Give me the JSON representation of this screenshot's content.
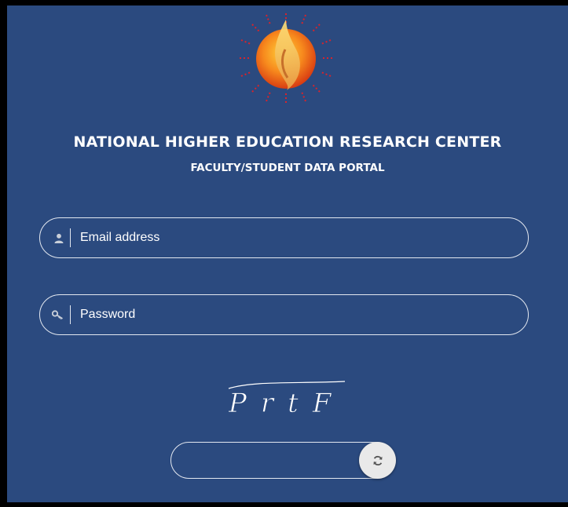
{
  "app": {
    "title": "NATIONAL HIGHER EDUCATION RESEARCH CENTER",
    "subtitle": "FACULTY/STUDENT DATA PORTAL"
  },
  "form": {
    "email": {
      "placeholder": "Email address",
      "value": ""
    },
    "password": {
      "placeholder": "Password",
      "value": ""
    },
    "captcha": {
      "text": "PrtF",
      "input_value": ""
    }
  },
  "icons": {
    "logo": "flame-sun-logo",
    "email": "user-icon",
    "password": "key-icon",
    "refresh": "refresh-icon"
  },
  "colors": {
    "background": "#2b4a7f",
    "border": "#e3e8f0",
    "text": "#ffffff",
    "logo_orange": "#f37a1f",
    "logo_rays": "#d9232b"
  }
}
